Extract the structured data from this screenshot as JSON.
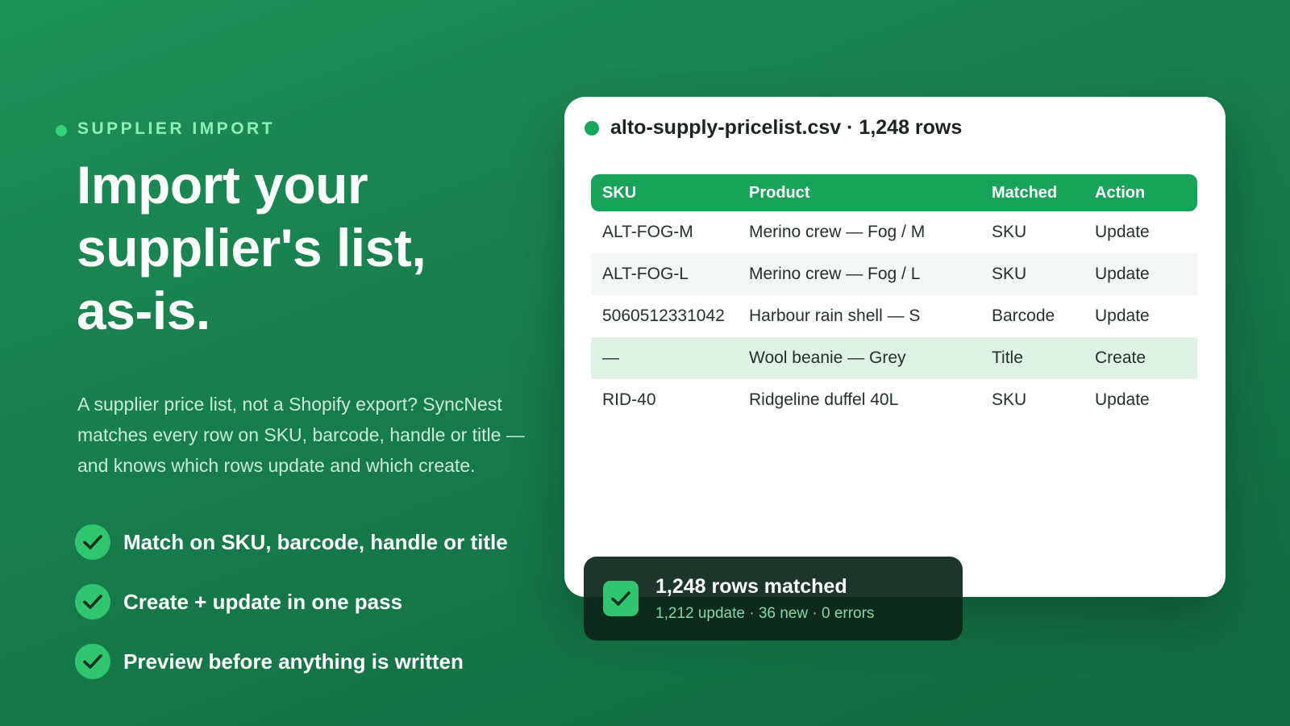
{
  "eyebrow": "SUPPLIER IMPORT",
  "headline": {
    "line1": "Import your",
    "line2": "supplier's list,",
    "line3": "as-is."
  },
  "description": {
    "line1": "A supplier price list, not a Shopify export? SyncNest",
    "line2": "matches every row on SKU, barcode, handle or title —",
    "line3": "and knows which rows update and which create."
  },
  "features": [
    {
      "label": "Match on SKU, barcode, handle or title",
      "icon": "check-circle-icon"
    },
    {
      "label": "Create + update in one pass",
      "icon": "check-circle-icon"
    },
    {
      "label": "Preview before anything is written",
      "icon": "check-circle-icon"
    }
  ],
  "card": {
    "title": "alto-supply-pricelist.csv · 1,248 rows",
    "columns": [
      "SKU",
      "Product",
      "Matched",
      "Action"
    ],
    "rows": [
      [
        "ALT-FOG-M",
        "Merino crew — Fog / M",
        "SKU",
        "Update"
      ],
      [
        "ALT-FOG-L",
        "Merino crew — Fog / L",
        "SKU",
        "Update"
      ],
      [
        "5060512331042",
        "Harbour rain shell — S",
        "Barcode",
        "Update"
      ],
      [
        "—",
        "Wool beanie — Grey",
        "Title",
        "Create"
      ],
      [
        "RID-40",
        "Ridgeline duffel 40L",
        "SKU",
        "Update"
      ]
    ]
  },
  "toast": {
    "title": "1,248 rows matched",
    "subtitle": "1,212 update · 36 new · 0 errors"
  },
  "colors": {
    "accent": "#17a35a",
    "background": "#177c4b",
    "highlight_row": "#dff2e6"
  }
}
